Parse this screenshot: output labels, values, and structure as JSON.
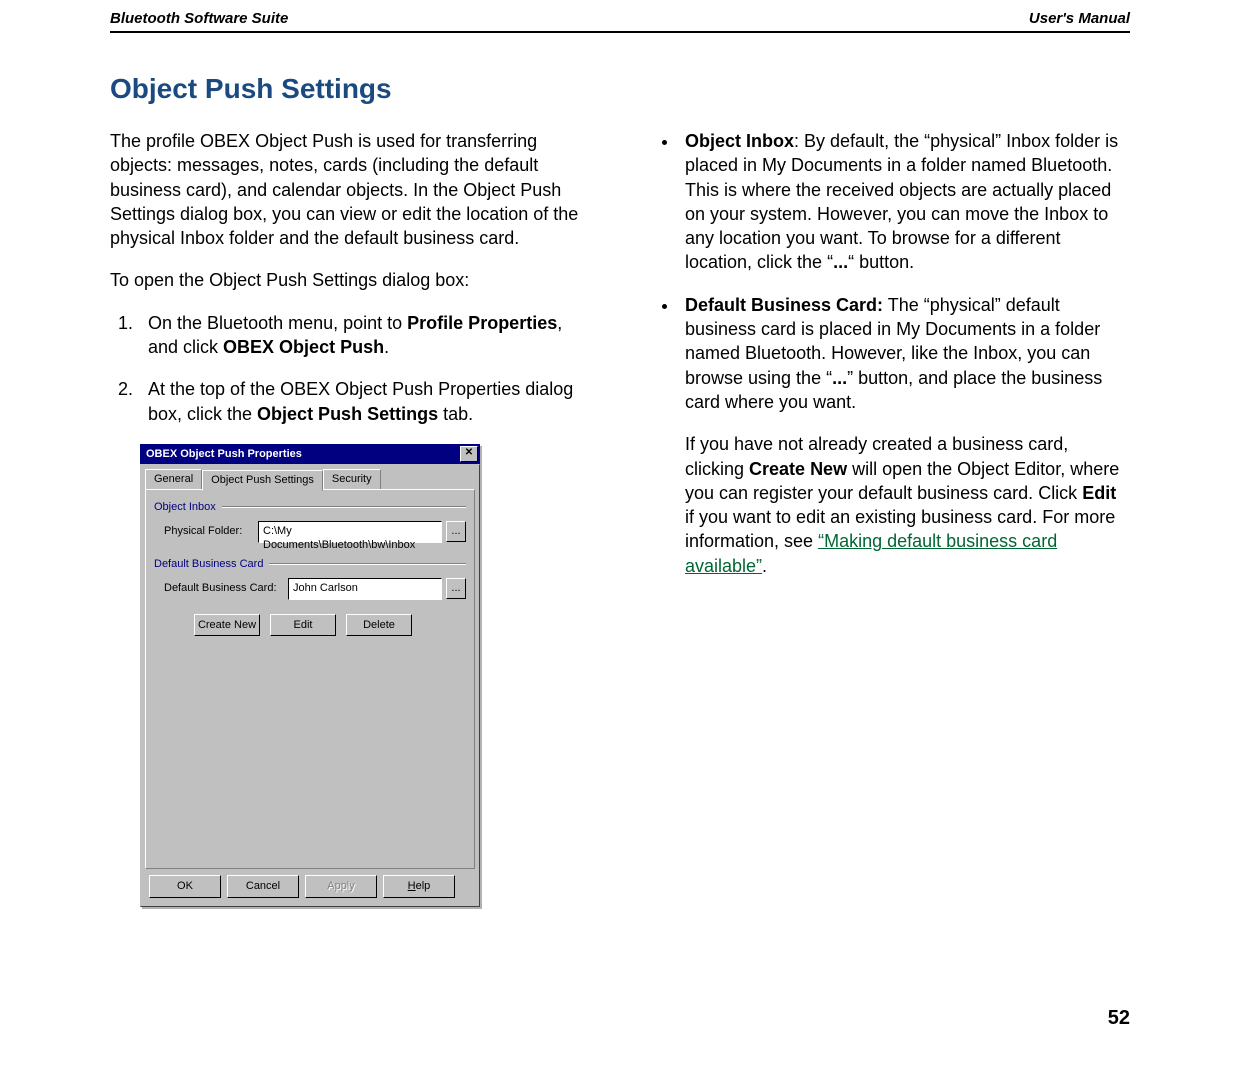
{
  "header": {
    "left": "Bluetooth Software Suite",
    "right": "User's Manual"
  },
  "section_title": "Object Push Settings",
  "left_col": {
    "intro": "The profile OBEX Object Push is used for transferring objects: messages, notes, cards (including the default business card), and calendar objects. In the Object Push Settings dialog box, you can view or edit the location of the physical Inbox folder and the default business card.",
    "open_line": "To open the Object Push Settings dialog box:",
    "step1_pre": "On the Bluetooth menu, point to ",
    "step1_bold1": "Profile Properties",
    "step1_mid": ", and click ",
    "step1_bold2": "OBEX Object Push",
    "step1_post": ".",
    "step2_pre": "At the top of the OBEX Object Push Properties dialog box, click the ",
    "step2_bold": "Object Push Settings",
    "step2_post": " tab."
  },
  "right_col": {
    "item1_bold": "Object Inbox",
    "item1_text_a": ": By default, the “physical” Inbox folder is placed in My Documents in a folder named Bluetooth. This is where the received objects are actually placed on your system. However, you can move the Inbox to any location you want. To browse for a different location, click the “",
    "item1_dots": "...",
    "item1_text_b": "“ button.",
    "item2_bold": "Default Business Card:",
    "item2_text_a": " The “physical” default business card is placed in My Documents in a folder named Bluetooth. However, like the Inbox, you can browse using the “",
    "item2_dots": "...",
    "item2_text_b": "” button, and place the business card where you want.",
    "item2_para2_a": "If you have not already created a business card, clicking ",
    "item2_para2_bold1": "Create New",
    "item2_para2_b": " will open the Object Editor, where you can register your default business card. Click ",
    "item2_para2_bold2": "Edit",
    "item2_para2_c": " if you want to edit an existing business card. For more information, see ",
    "item2_link": "“Making default business card available”",
    "item2_para2_d": "."
  },
  "dialog": {
    "title": "OBEX Object Push Properties",
    "close_glyph": "✕",
    "tabs": {
      "general": "General",
      "ops": "Object Push Settings",
      "security": "Security"
    },
    "group1": "Object Inbox",
    "field1_label": "Physical Folder:",
    "field1_value": "C:\\My Documents\\Bluetooth\\bw\\Inbox",
    "browse": "...",
    "group2": "Default Business Card",
    "field2_label": "Default Business Card:",
    "field2_value": "John Carlson",
    "btn_create": "Create New",
    "btn_edit": "Edit",
    "btn_delete": "Delete",
    "footer": {
      "ok": "OK",
      "cancel": "Cancel",
      "apply": "Apply",
      "help_u": "H",
      "help_rest": "elp"
    }
  },
  "page_number": "52"
}
